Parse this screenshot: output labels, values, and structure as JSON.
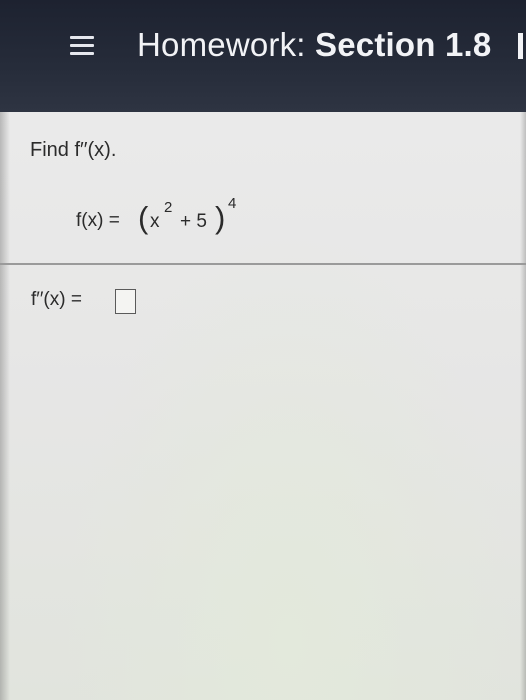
{
  "header": {
    "menu_icon": "hamburger-menu-icon",
    "title_prefix": "Homework: ",
    "title_section": "Section 1.8"
  },
  "question": {
    "prompt": "Find f′′(x).",
    "function_lhs": "f(x) = ",
    "function_base": "x",
    "function_inner_exp": "2",
    "function_rest": "+ 5",
    "function_outer_exp": "4",
    "open_paren": "(",
    "close_paren": ")"
  },
  "answer": {
    "label": "f′′(x) = ",
    "value": ""
  }
}
